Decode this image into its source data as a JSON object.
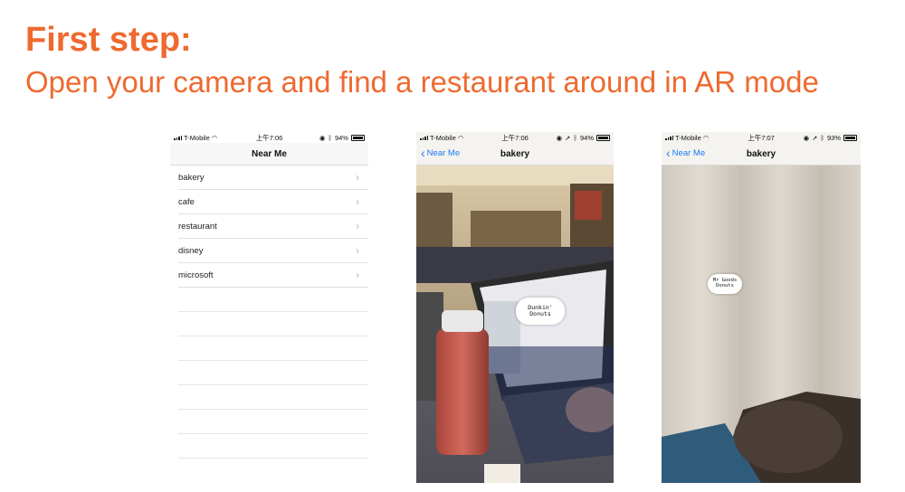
{
  "slide": {
    "title": "First step:",
    "subtitle": "Open your camera and find a restaurant around in AR mode"
  },
  "phones": [
    {
      "status": {
        "carrier": "T-Mobile",
        "time": "上午7:06",
        "battery": "94%"
      },
      "nav_title": "Near Me",
      "list_items": [
        "bakery",
        "cafe",
        "restaurant",
        "disney",
        "microsoft"
      ]
    },
    {
      "status": {
        "carrier": "T-Mobile",
        "time": "上午7:06",
        "battery": "94%"
      },
      "back_label": "Near Me",
      "nav_title": "bakery",
      "ar_label": "Dunkin' Donuts"
    },
    {
      "status": {
        "carrier": "T-Mobile",
        "time": "上午7:07",
        "battery": "93%"
      },
      "back_label": "Near Me",
      "nav_title": "bakery",
      "ar_label": "Mr Goods Donuts"
    }
  ],
  "colors": {
    "accent": "#ee6a2f",
    "ios_blue": "#1a7cf5"
  },
  "icons": [
    "wifi-icon",
    "signal-icon",
    "battery-icon",
    "bluetooth-icon",
    "location-icon",
    "chevron-right-icon",
    "chevron-left-icon"
  ]
}
